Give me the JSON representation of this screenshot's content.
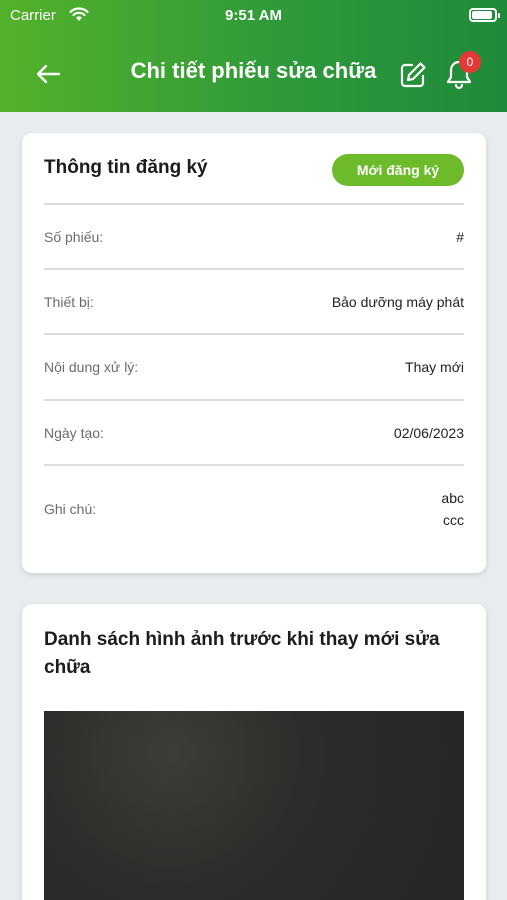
{
  "status_bar": {
    "carrier": "Carrier",
    "time": "9:51 AM"
  },
  "nav": {
    "title": "Chi tiết phiếu sửa chữa",
    "notification_count": "0"
  },
  "registration": {
    "title": "Thông tin đăng ký",
    "status": "Mới đăng ký",
    "rows": [
      {
        "label": "Số phiếu:",
        "value": "#"
      },
      {
        "label": "Thiết bị:",
        "value": "Bảo dưỡng máy phát"
      },
      {
        "label": "Nội dung xử lý:",
        "value": "Thay mới"
      },
      {
        "label": "Ngày tạo:",
        "value": "02/06/2023"
      },
      {
        "label": "Ghi chú:",
        "value_line1": "abc",
        "value_line2": "ccc"
      }
    ]
  },
  "images_section": {
    "title": "Danh sách hình ảnh trước khi thay mới sửa chữa"
  },
  "colors": {
    "header_start": "#53b22a",
    "header_end": "#1f8a3a",
    "status_pill": "#6dbb2b",
    "badge": "#e53935"
  }
}
